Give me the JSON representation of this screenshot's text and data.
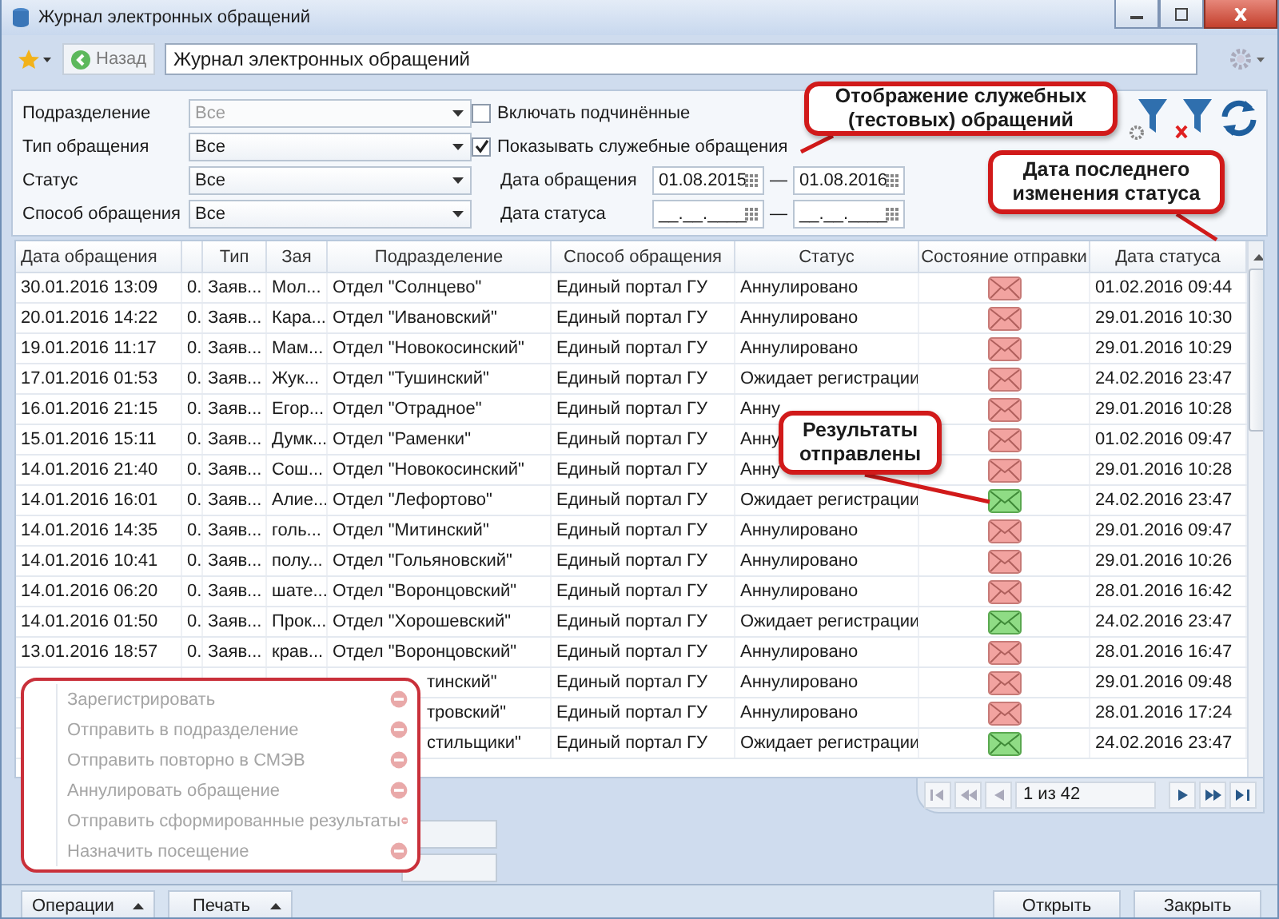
{
  "window": {
    "title": "Журнал электронных обращений"
  },
  "toolbar": {
    "back_button": "Назад",
    "address": "Журнал электронных обращений"
  },
  "filters": {
    "selects": [
      {
        "label": "Подразделение",
        "value": "Все",
        "disabled": true
      },
      {
        "label": "Тип обращения",
        "value": "Все",
        "disabled": false
      },
      {
        "label": "Статус",
        "value": "Все",
        "disabled": false
      },
      {
        "label": "Способ обращения",
        "value": "Все",
        "disabled": false
      }
    ],
    "checkboxes": [
      {
        "label": "Включать подчинённые",
        "checked": false
      },
      {
        "label": "Показывать служебные обращения",
        "checked": true
      }
    ],
    "date_ranges": [
      {
        "label": "Дата обращения",
        "from": "01.08.2015",
        "separator": "—",
        "to": "01.08.2016"
      },
      {
        "label": "Дата статуса",
        "from": "__.__.____",
        "separator": "—",
        "to": "__.__.____"
      }
    ]
  },
  "table": {
    "columns": [
      {
        "kind": "text",
        "label": "Дата обращения"
      },
      {
        "kind": "number"
      },
      {
        "kind": "text",
        "label": "Тип"
      },
      {
        "kind": "text",
        "label": "Зая"
      },
      {
        "kind": "text",
        "label": "Подразделение"
      },
      {
        "kind": "text",
        "label": "Способ обращения"
      },
      {
        "kind": "text",
        "label": "Статус"
      },
      {
        "kind": "text",
        "label": "Состояние отправки"
      },
      {
        "kind": "text",
        "label": "Дата статуса"
      }
    ],
    "rows": [
      {
        "kind": "full",
        "date": "30.01.2016 13:09",
        "number": "0.",
        "type": "Заяв...",
        "applicant": "Мол...",
        "subdivision": "Отдел \"Солнцево\"",
        "method": "Единый портал ГУ",
        "status": "Аннулировано",
        "sent": false,
        "status_date": "01.02.2016 09:44"
      },
      {
        "kind": "full",
        "date": "20.01.2016 14:22",
        "number": "0.",
        "type": "Заяв...",
        "applicant": "Кара...",
        "subdivision": "Отдел \"Ивановский\"",
        "method": "Единый портал ГУ",
        "status": "Аннулировано",
        "sent": false,
        "status_date": "29.01.2016 10:30"
      },
      {
        "kind": "full",
        "date": "19.01.2016 11:17",
        "number": "0.",
        "type": "Заяв...",
        "applicant": "Мам...",
        "subdivision": "Отдел \"Новокосинский\"",
        "method": "Единый портал ГУ",
        "status": "Аннулировано",
        "sent": false,
        "status_date": "29.01.2016 10:29"
      },
      {
        "kind": "full",
        "date": "17.01.2016 01:53",
        "number": "0.",
        "type": "Заяв...",
        "applicant": "Жук...",
        "subdivision": "Отдел \"Тушинский\"",
        "method": "Единый портал ГУ",
        "status": "Ожидает регистрации",
        "sent": false,
        "status_date": "24.02.2016 23:47"
      },
      {
        "kind": "full",
        "date": "16.01.2016 21:15",
        "number": "0.",
        "type": "Заяв...",
        "applicant": "Егор...",
        "subdivision": "Отдел \"Отрадное\"",
        "method": "Единый портал ГУ",
        "status": "Анну",
        "sent": false,
        "status_date": "29.01.2016 10:28"
      },
      {
        "kind": "full",
        "date": "15.01.2016 15:11",
        "number": "0.",
        "type": "Заяв...",
        "applicant": "Думк...",
        "subdivision": "Отдел \"Раменки\"",
        "method": "Единый портал ГУ",
        "status": "Анну",
        "sent": false,
        "status_date": "01.02.2016 09:47"
      },
      {
        "kind": "full",
        "date": "14.01.2016 21:40",
        "number": "0.",
        "type": "Заяв...",
        "applicant": "Сош...",
        "subdivision": "Отдел \"Новокосинский\"",
        "method": "Единый портал ГУ",
        "status": "Анну",
        "sent": false,
        "status_date": "29.01.2016 10:28"
      },
      {
        "kind": "full",
        "date": "14.01.2016 16:01",
        "number": "0.",
        "type": "Заяв...",
        "applicant": "Алие...",
        "subdivision": "Отдел \"Лефортово\"",
        "method": "Единый портал ГУ",
        "status": "Ожидает регистрации",
        "sent": true,
        "status_date": "24.02.2016 23:47"
      },
      {
        "kind": "full",
        "date": "14.01.2016 14:35",
        "number": "0.",
        "type": "Заяв...",
        "applicant": "голь...",
        "subdivision": "Отдел \"Митинский\"",
        "method": "Единый портал ГУ",
        "status": "Аннулировано",
        "sent": false,
        "status_date": "29.01.2016 09:47"
      },
      {
        "kind": "full",
        "date": "14.01.2016 10:41",
        "number": "0.",
        "type": "Заяв...",
        "applicant": "полу...",
        "subdivision": "Отдел \"Гольяновский\"",
        "method": "Единый портал ГУ",
        "status": "Аннулировано",
        "sent": false,
        "status_date": "29.01.2016 10:26"
      },
      {
        "kind": "full",
        "date": "14.01.2016 06:20",
        "number": "0.",
        "type": "Заяв...",
        "applicant": "шате...",
        "subdivision": "Отдел \"Воронцовский\"",
        "method": "Единый портал ГУ",
        "status": "Аннулировано",
        "sent": false,
        "status_date": "28.01.2016 16:42"
      },
      {
        "kind": "full",
        "date": "14.01.2016 01:50",
        "number": "0.",
        "type": "Заяв...",
        "applicant": "Прок...",
        "subdivision": "Отдел \"Хорошевский\"",
        "method": "Единый портал ГУ",
        "status": "Ожидает регистрации",
        "sent": true,
        "status_date": "24.02.2016 23:47"
      },
      {
        "kind": "full",
        "date": "13.01.2016 18:57",
        "number": "0.",
        "type": "Заяв...",
        "applicant": "крав...",
        "subdivision": "Отдел \"Воронцовский\"",
        "method": "Единый портал ГУ",
        "status": "Аннулировано",
        "sent": false,
        "status_date": "28.01.2016 16:47"
      },
      {
        "kind": "covered",
        "subdivision": "тинский\"",
        "method": "Единый портал ГУ",
        "status": "Аннулировано",
        "sent": false,
        "status_date": "29.01.2016 09:48"
      },
      {
        "kind": "covered",
        "subdivision": "тровский\"",
        "method": "Единый портал ГУ",
        "status": "Аннулировано",
        "sent": false,
        "status_date": "28.01.2016 17:24"
      },
      {
        "kind": "covered",
        "subdivision": "стильщики\"",
        "method": "Единый портал ГУ",
        "status": "Ожидает регистрации",
        "sent": true,
        "status_date": "24.02.2016 23:47"
      }
    ]
  },
  "pager": {
    "info": "1 из 42"
  },
  "operations_menu": {
    "items": [
      {
        "label": "Зарегистрировать",
        "disabled": true
      },
      {
        "label": "Отправить в подразделение",
        "disabled": true
      },
      {
        "label": "Отправить повторно в СМЭВ",
        "disabled": true
      },
      {
        "label": "Аннулировать обращение",
        "disabled": true
      },
      {
        "label": "Отправить сформированные результаты",
        "disabled": true
      },
      {
        "label": "Назначить посещение",
        "disabled": true
      }
    ]
  },
  "buttons": {
    "operations": "Операции",
    "print": "Печать",
    "open": "Открыть",
    "close": "Закрыть"
  },
  "callouts": [
    {
      "text": "Отображение служебных\n(тестовых) обращений"
    },
    {
      "text": "Дата последнего\nизменения статуса"
    },
    {
      "text": "Результаты\nотправлены"
    }
  ]
}
